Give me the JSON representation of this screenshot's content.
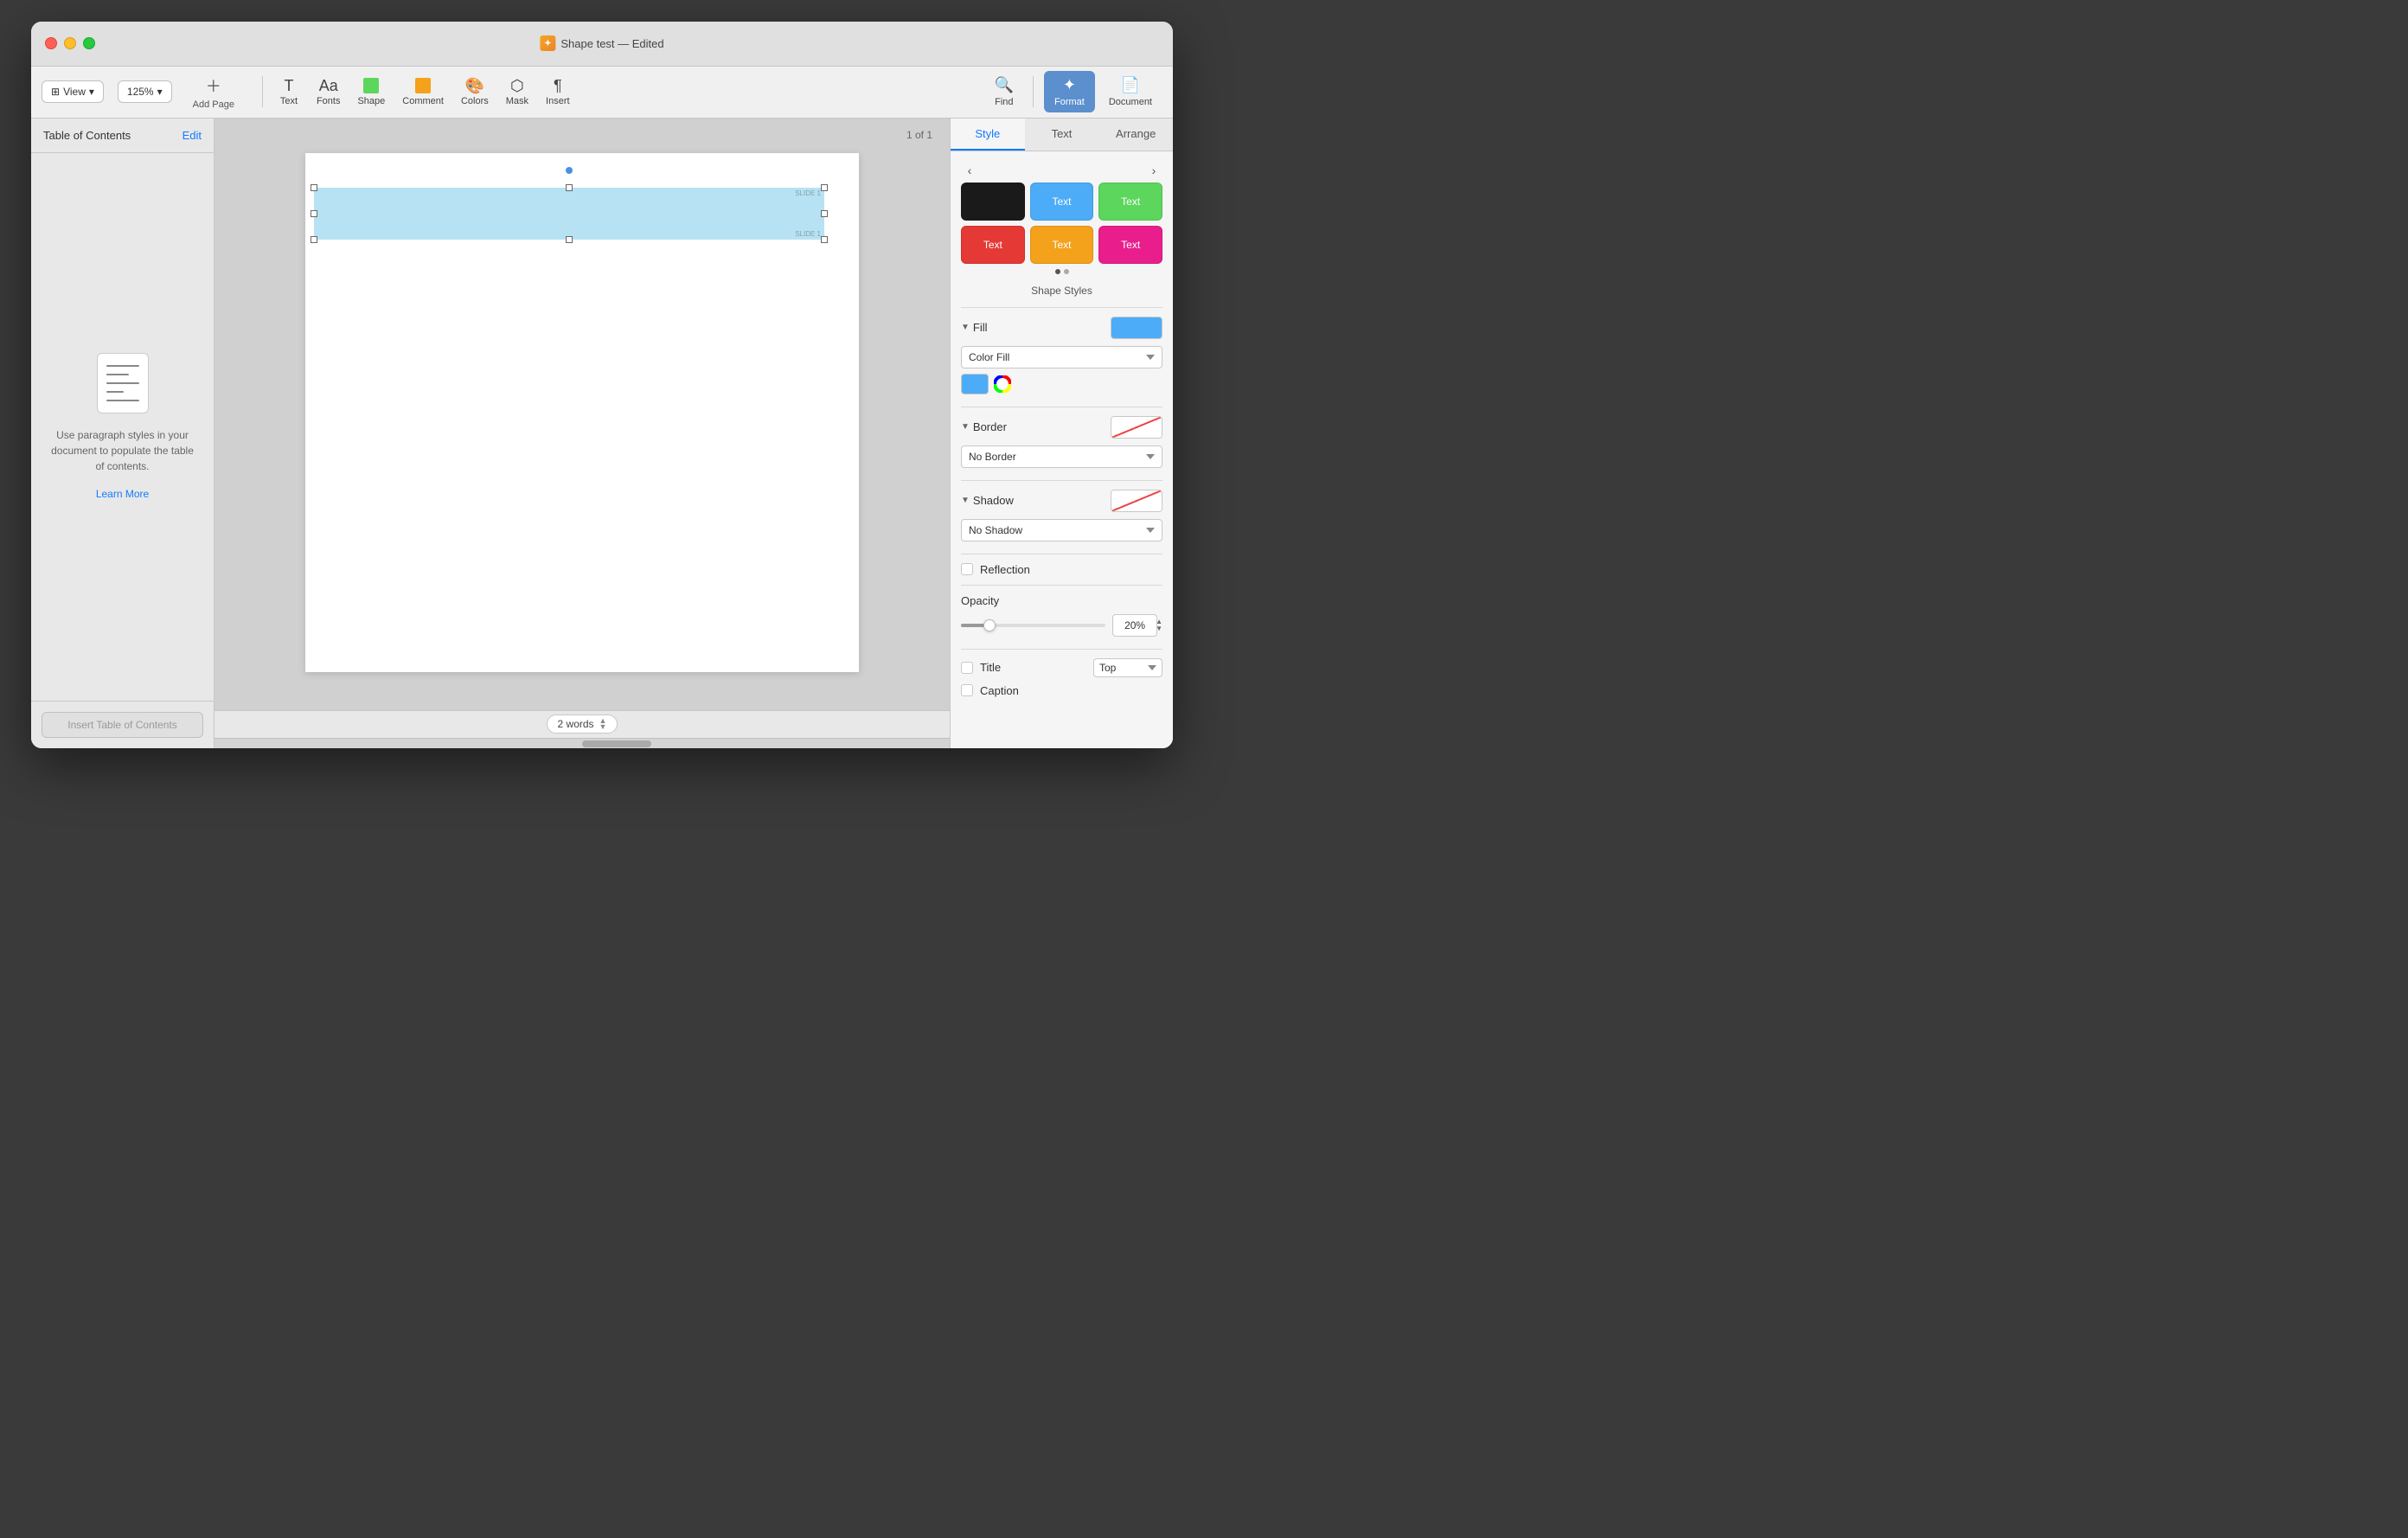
{
  "window": {
    "title": "Shape test — Edited",
    "icon": "✦"
  },
  "titlebar": {
    "close": "●",
    "minimize": "●",
    "maximize": "●"
  },
  "toolbar": {
    "view_label": "View",
    "zoom_value": "125%",
    "add_page_label": "Add Page",
    "text_label": "Text",
    "fonts_label": "Fonts",
    "shape_label": "Shape",
    "comment_label": "Comment",
    "colors_label": "Colors",
    "mask_label": "Mask",
    "insert_label": "Insert",
    "find_label": "Find",
    "format_label": "Format",
    "document_label": "Document"
  },
  "sidebar": {
    "title": "Table of Contents",
    "edit_label": "Edit",
    "info_text": "Use paragraph styles in your document to populate the table of contents.",
    "learn_more_label": "Learn More",
    "insert_btn_label": "Insert Table of Contents"
  },
  "canvas": {
    "page_number": "1 of 1",
    "word_count": "2 words"
  },
  "shape": {
    "slide_label_1": "SLIDE 1",
    "slide_label_2": "SLIDE 1"
  },
  "right_panel": {
    "tabs": [
      "Style",
      "Text",
      "Arrange"
    ],
    "active_tab": "Style",
    "style_swatches": [
      {
        "bg": "#1a1a1a",
        "text": "",
        "text_color": "white",
        "style": "solid-black"
      },
      {
        "bg": "#4dacf7",
        "text": "Text",
        "text_color": "white",
        "style": "blue-text"
      },
      {
        "bg": "#5cd65c",
        "text": "Text",
        "text_color": "white",
        "style": "green-text"
      },
      {
        "bg": "#e53935",
        "text": "Text",
        "text_color": "white",
        "style": "red-text"
      },
      {
        "bg": "#f4a11b",
        "text": "Text",
        "text_color": "white",
        "style": "orange-text"
      },
      {
        "bg": "#e91e8c",
        "text": "Text",
        "text_color": "white",
        "style": "pink-text"
      }
    ],
    "shape_styles_label": "Shape Styles",
    "fill": {
      "label": "Fill",
      "type": "Color Fill",
      "color": "#4dacf7"
    },
    "border": {
      "label": "Border",
      "type": "No Border"
    },
    "shadow": {
      "label": "Shadow",
      "type": "No Shadow"
    },
    "reflection_label": "Reflection",
    "opacity_label": "Opacity",
    "opacity_value": "20%",
    "title_label": "Title",
    "title_position": "Top",
    "caption_label": "Caption"
  }
}
